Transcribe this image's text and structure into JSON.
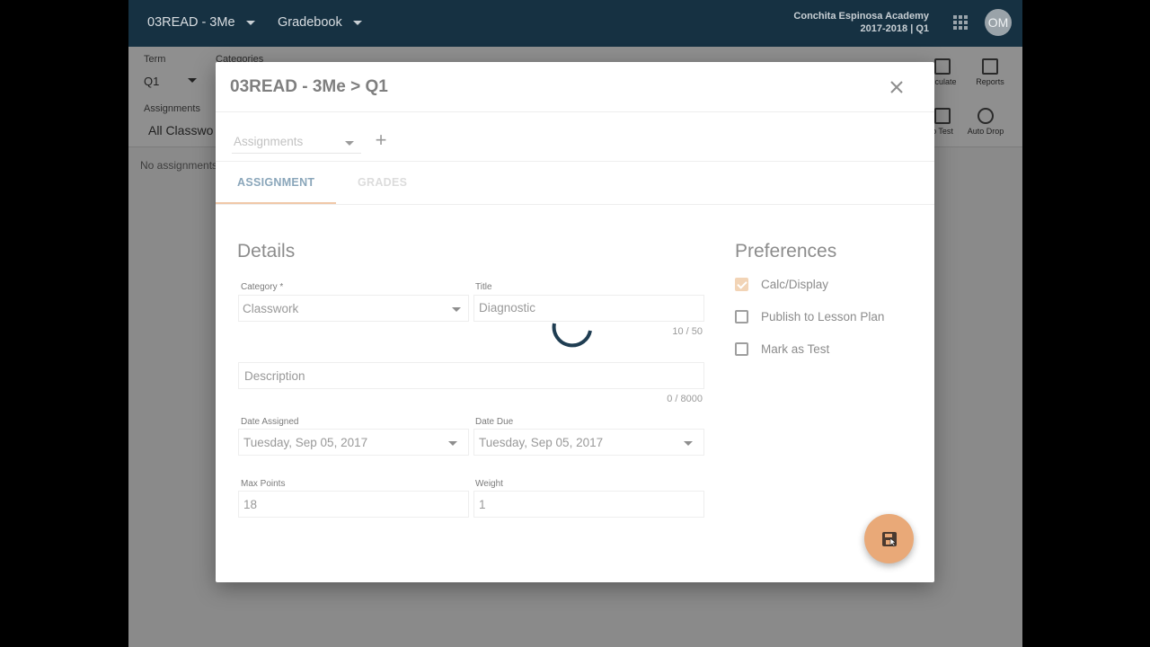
{
  "topbar": {
    "course_label": "03READ - 3Me",
    "view_label": "Gradebook",
    "school_name": "Conchita Espinosa Academy",
    "school_year": "2017-2018 | Q1",
    "avatar_initials": "OM"
  },
  "toolbar": {
    "term_label": "Term",
    "term_value": "Q1",
    "categories_label": "Categories",
    "assignments_label": "Assignments",
    "assignments_value": "All Classwo",
    "calculate_label": "alculate",
    "reports_label": "Reports",
    "test_label": "b Test",
    "auto_drop_label": "Auto Drop",
    "empty_message": "No assignments"
  },
  "dialog": {
    "title": "03READ - 3Me > Q1",
    "assignments_placeholder": "Assignments",
    "tabs": [
      {
        "label": "ASSIGNMENT",
        "active": true
      },
      {
        "label": "GRADES",
        "active": false
      }
    ],
    "details_heading": "Details",
    "category": {
      "label": "Category *",
      "value": "Classwork"
    },
    "title_field": {
      "label": "Title",
      "value": "Diagnostic",
      "counter": "10 / 50"
    },
    "description": {
      "placeholder": "Description",
      "counter": "0 / 8000"
    },
    "date_assigned": {
      "label": "Date Assigned",
      "value": "Tuesday, Sep 05, 2017"
    },
    "date_due": {
      "label": "Date Due",
      "value": "Tuesday, Sep 05, 2017"
    },
    "max_points": {
      "label": "Max Points",
      "value": "18"
    },
    "weight": {
      "label": "Weight",
      "value": "1"
    },
    "preferences_heading": "Preferences",
    "preferences": [
      {
        "label": "Calc/Display",
        "checked": true
      },
      {
        "label": "Publish to Lesson Plan",
        "checked": false
      },
      {
        "label": "Mark as Test",
        "checked": false
      }
    ]
  },
  "colors": {
    "topbar_bg": "#163142",
    "accent_orange": "#e9a978",
    "tab_active": "#8aa6ba",
    "spinner": "#1f3d52"
  }
}
